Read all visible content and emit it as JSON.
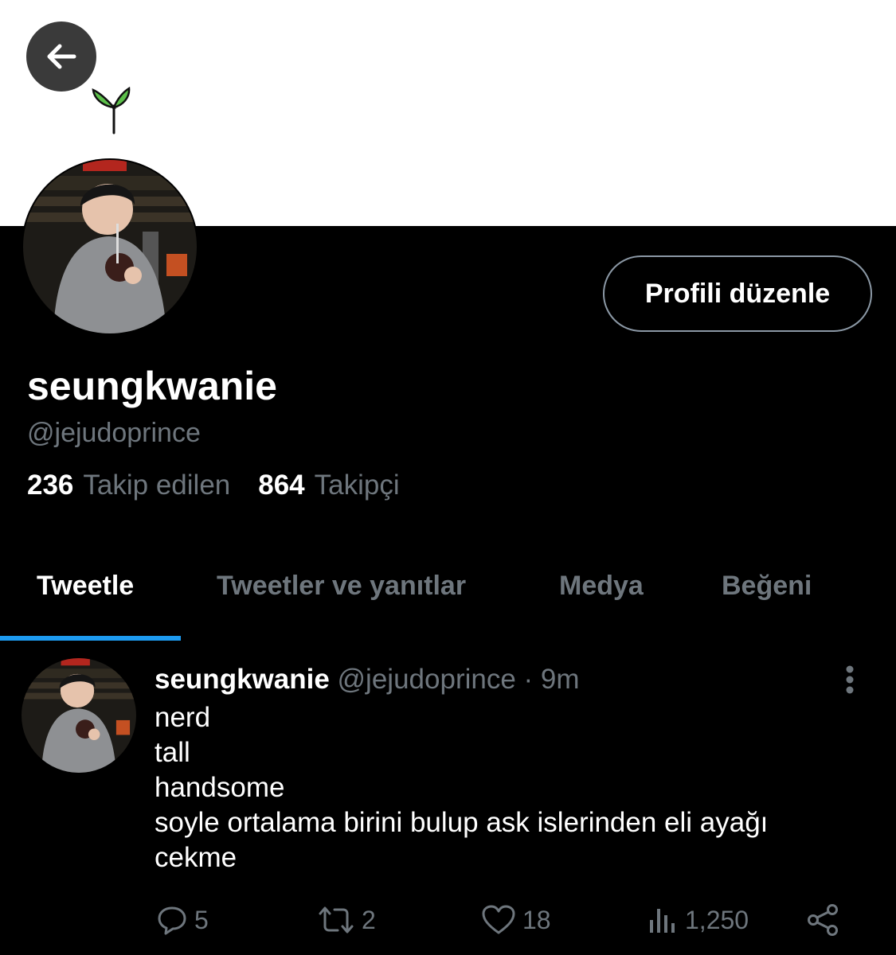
{
  "header": {
    "back_icon": "arrow-left-icon",
    "decoration_icon": "sprout-icon"
  },
  "profile": {
    "edit_label": "Profili düzenle",
    "display_name": "seungkwanie",
    "handle": "@jejudoprince",
    "following_count": "236",
    "following_label": "Takip edilen",
    "followers_count": "864",
    "followers_label": "Takipçi"
  },
  "tabs": [
    {
      "label": "Tweetle",
      "active": true
    },
    {
      "label": "Tweetler ve yanıtlar",
      "active": false
    },
    {
      "label": "Medya",
      "active": false
    },
    {
      "label": "Beğeni",
      "active": false
    }
  ],
  "tweet": {
    "name": "seungkwanie",
    "handle_time": "@jejudoprince · 9m",
    "lines": [
      "nerd",
      "tall",
      "handsome",
      "soyle ortalama birini bulup ask islerinden eli ayağı",
      "cekme"
    ],
    "actions": {
      "replies": "5",
      "retweets": "2",
      "likes": "18",
      "views": "1,250"
    }
  },
  "colors": {
    "background": "#000000",
    "banner": "#ffffff",
    "accent": "#1d9bf0",
    "muted_text": "#6e767d",
    "sprout_green": "#5cc04a"
  }
}
